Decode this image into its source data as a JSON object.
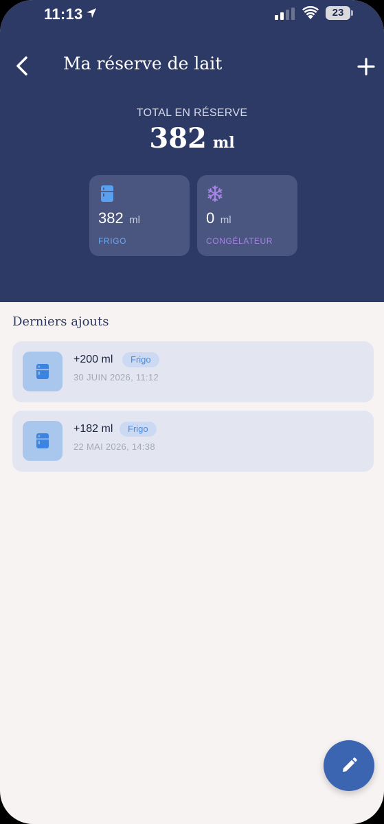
{
  "status_bar": {
    "time": "11:13",
    "battery": "23"
  },
  "header": {
    "title": "Ma réserve de lait"
  },
  "total": {
    "label": "TOTAL EN RÉSERVE",
    "value": "382",
    "unit": "ml"
  },
  "storage": {
    "frigo": {
      "amount": "382",
      "unit": "ml",
      "label": "FRIGO"
    },
    "congelateur": {
      "amount": "0",
      "unit": "ml",
      "label": "CONGÉLATEUR"
    }
  },
  "recent": {
    "title": "Derniers ajouts",
    "entries": [
      {
        "amount": "+200 ml",
        "location": "Frigo",
        "date": "30 JUIN 2026, 11:12"
      },
      {
        "amount": "+182 ml",
        "location": "Frigo",
        "date": "22 MAI 2026, 14:38"
      }
    ]
  },
  "colors": {
    "header_bg": "#2d3a66",
    "frigo_accent": "#6aa6ef",
    "congelateur_accent": "#a684e6",
    "fab_bg": "#3b64b1"
  },
  "icons": {
    "back": "chevron-left-icon",
    "add": "plus-icon",
    "frigo": "fridge-icon",
    "congelateur": "snowflake-icon",
    "fab": "pencil-icon"
  }
}
